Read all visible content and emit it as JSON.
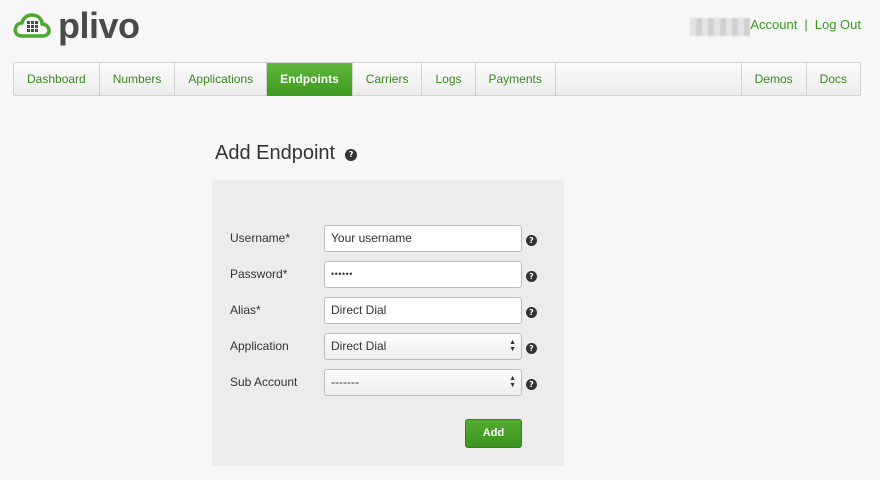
{
  "brand": {
    "name": "plivo"
  },
  "header": {
    "account_label": "Account",
    "separator": "|",
    "logout_label": "Log Out"
  },
  "nav": {
    "items": [
      {
        "label": "Dashboard"
      },
      {
        "label": "Numbers"
      },
      {
        "label": "Applications"
      },
      {
        "label": "Endpoints",
        "active": true
      },
      {
        "label": "Carriers"
      },
      {
        "label": "Logs"
      },
      {
        "label": "Payments"
      }
    ],
    "right_items": [
      {
        "label": "Demos"
      },
      {
        "label": "Docs"
      }
    ]
  },
  "page": {
    "title": "Add Endpoint",
    "help_glyph": "?"
  },
  "form": {
    "username": {
      "label": "Username*",
      "value": "Your username"
    },
    "password": {
      "label": "Password*",
      "value": "••••••"
    },
    "alias": {
      "label": "Alias*",
      "value": "Direct Dial"
    },
    "application": {
      "label": "Application",
      "value": "Direct Dial"
    },
    "sub_account": {
      "label": "Sub Account",
      "value": "-------"
    },
    "submit_label": "Add"
  },
  "colors": {
    "brand_green": "#3a9a20",
    "active_tab": "#4aa82b",
    "panel_bg": "#ececec",
    "page_bg": "#f7f7f7"
  },
  "icons": {
    "logo": "cloud-grid-icon",
    "help": "question-circle-icon",
    "select": "updown-arrows-icon"
  }
}
